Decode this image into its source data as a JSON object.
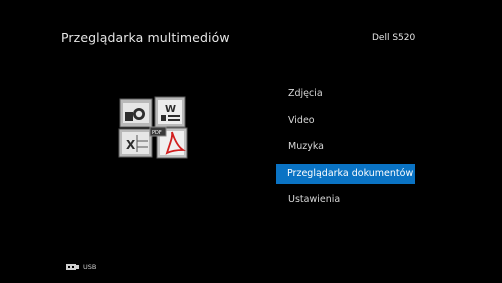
{
  "header": {
    "title": "Przeglądarka multimediów",
    "model": "Dell S520"
  },
  "menu": {
    "items": [
      {
        "label": "Zdjęcia"
      },
      {
        "label": "Video"
      },
      {
        "label": "Muzyka"
      },
      {
        "label": "Przeglądarka dokumentów"
      },
      {
        "label": "Ustawienia"
      }
    ],
    "selected_index": 3
  },
  "icons": {
    "documents": "documents-icon",
    "usb": "usb-icon"
  },
  "footer": {
    "source_label": "USB"
  },
  "colors": {
    "background": "#000000",
    "selection": "#0a73c4",
    "text": "#e6e6e6"
  }
}
